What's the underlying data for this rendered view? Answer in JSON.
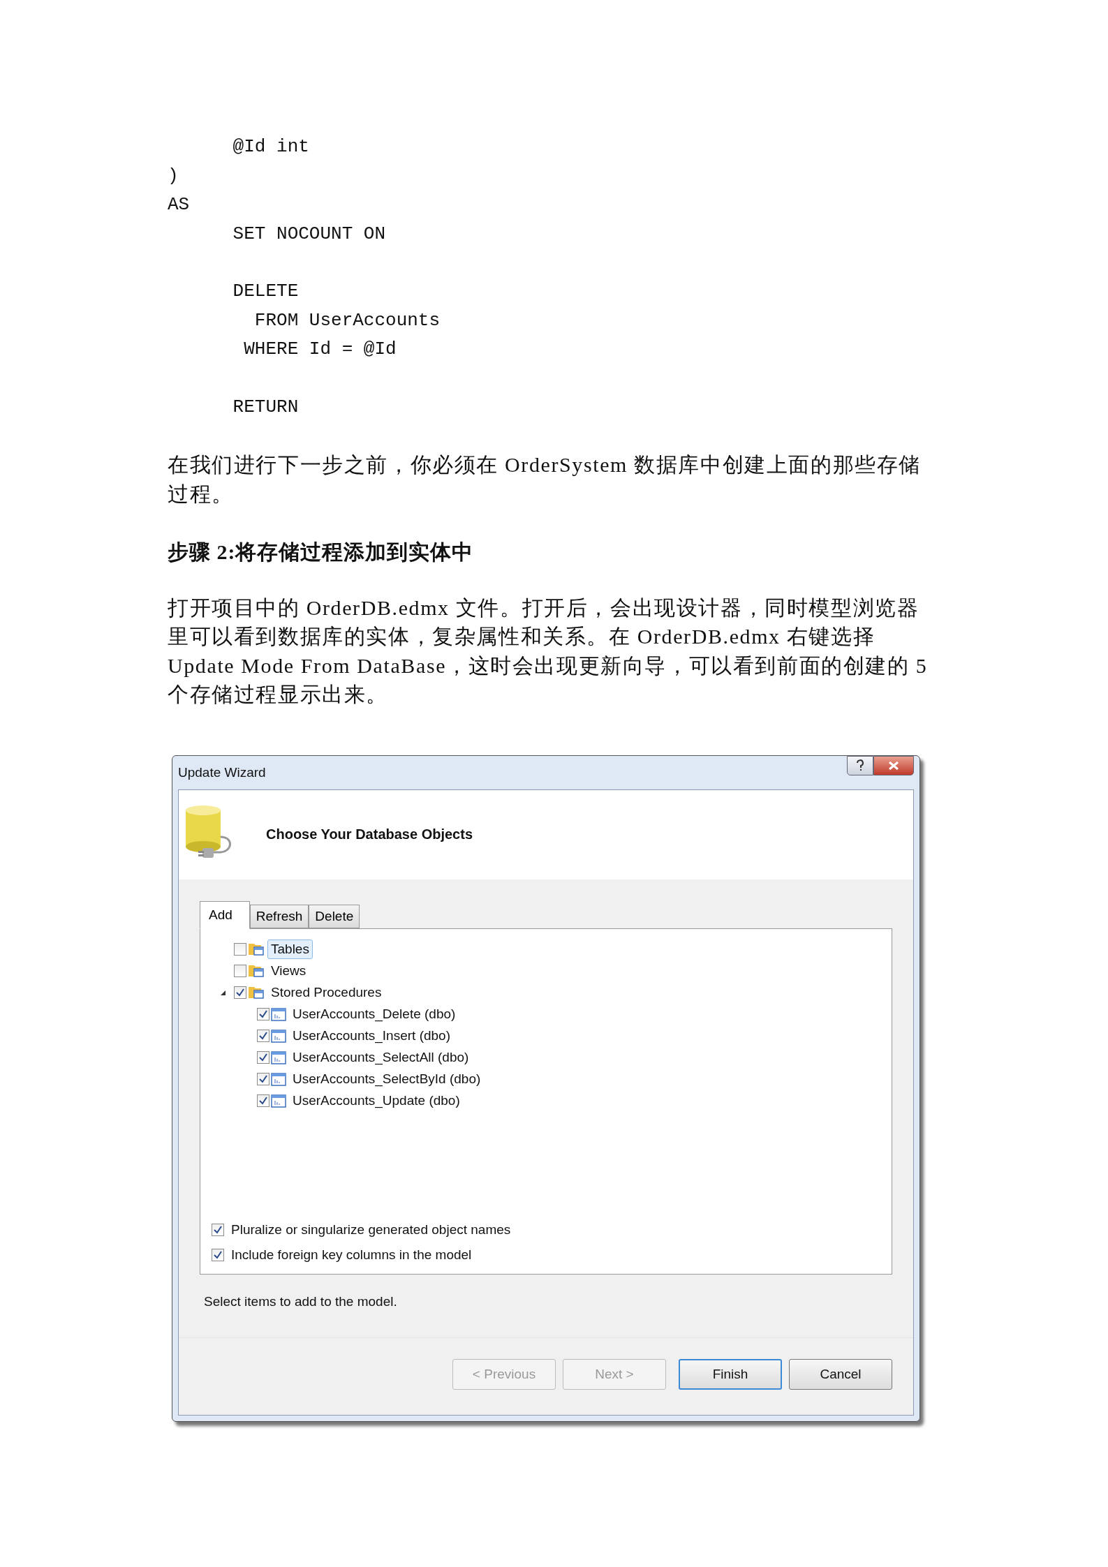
{
  "code_blocks": [
    [
      "      @Id int",
      ")",
      "AS",
      "      SET NOCOUNT ON"
    ],
    [
      "      DELETE",
      "        FROM UserAccounts",
      "       WHERE Id = @Id"
    ],
    [
      "      RETURN"
    ]
  ],
  "note": "在我们进行下一步之前，你必须在 OrderSystem 数据库中创建上面的那些存储过程。",
  "heading": "步骤 2:将存储过程添加到实体中",
  "paragraph": "打开项目中的 OrderDB.edmx 文件。打开后，会出现设计器，同时模型浏览器里可以看到数据库的实体，复杂属性和关系。在 OrderDB.edmx 右键选择 Update Mode From DataBase，这时会出现更新向导，可以看到前面的创建的 5 个存储过程显示出来。",
  "dialog": {
    "title": "Update Wizard",
    "header": "Choose Your Database Objects",
    "tabs": [
      {
        "label": "Add",
        "selected": true
      },
      {
        "label": "Refresh",
        "selected": false
      },
      {
        "label": "Delete",
        "selected": false
      }
    ],
    "tree": [
      {
        "label": "Tables",
        "checked": false,
        "selected": true
      },
      {
        "label": "Views",
        "checked": false,
        "selected": false
      },
      {
        "label": "Stored Procedures",
        "checked": true,
        "selected": false,
        "expanded": true,
        "children": [
          {
            "label": "UserAccounts_Delete (dbo)",
            "checked": true,
            "selected": false
          },
          {
            "label": "UserAccounts_Insert (dbo)",
            "checked": true,
            "selected": false
          },
          {
            "label": "UserAccounts_SelectAll (dbo)",
            "checked": true,
            "selected": false
          },
          {
            "label": "UserAccounts_SelectById (dbo)",
            "checked": true,
            "selected": false
          },
          {
            "label": "UserAccounts_Update (dbo)",
            "checked": true,
            "selected": false
          }
        ]
      }
    ],
    "options": [
      {
        "label": "Pluralize or singularize generated object names",
        "checked": true
      },
      {
        "label": "Include foreign key columns in the model",
        "checked": true
      }
    ],
    "status": "Select items to add to the model.",
    "buttons": [
      {
        "label": "< Previous",
        "disabled": true,
        "default": false
      },
      {
        "label": "Next >",
        "disabled": true,
        "default": false
      },
      {
        "label": "Finish",
        "disabled": false,
        "default": true
      },
      {
        "label": "Cancel",
        "disabled": false,
        "default": false
      }
    ]
  }
}
